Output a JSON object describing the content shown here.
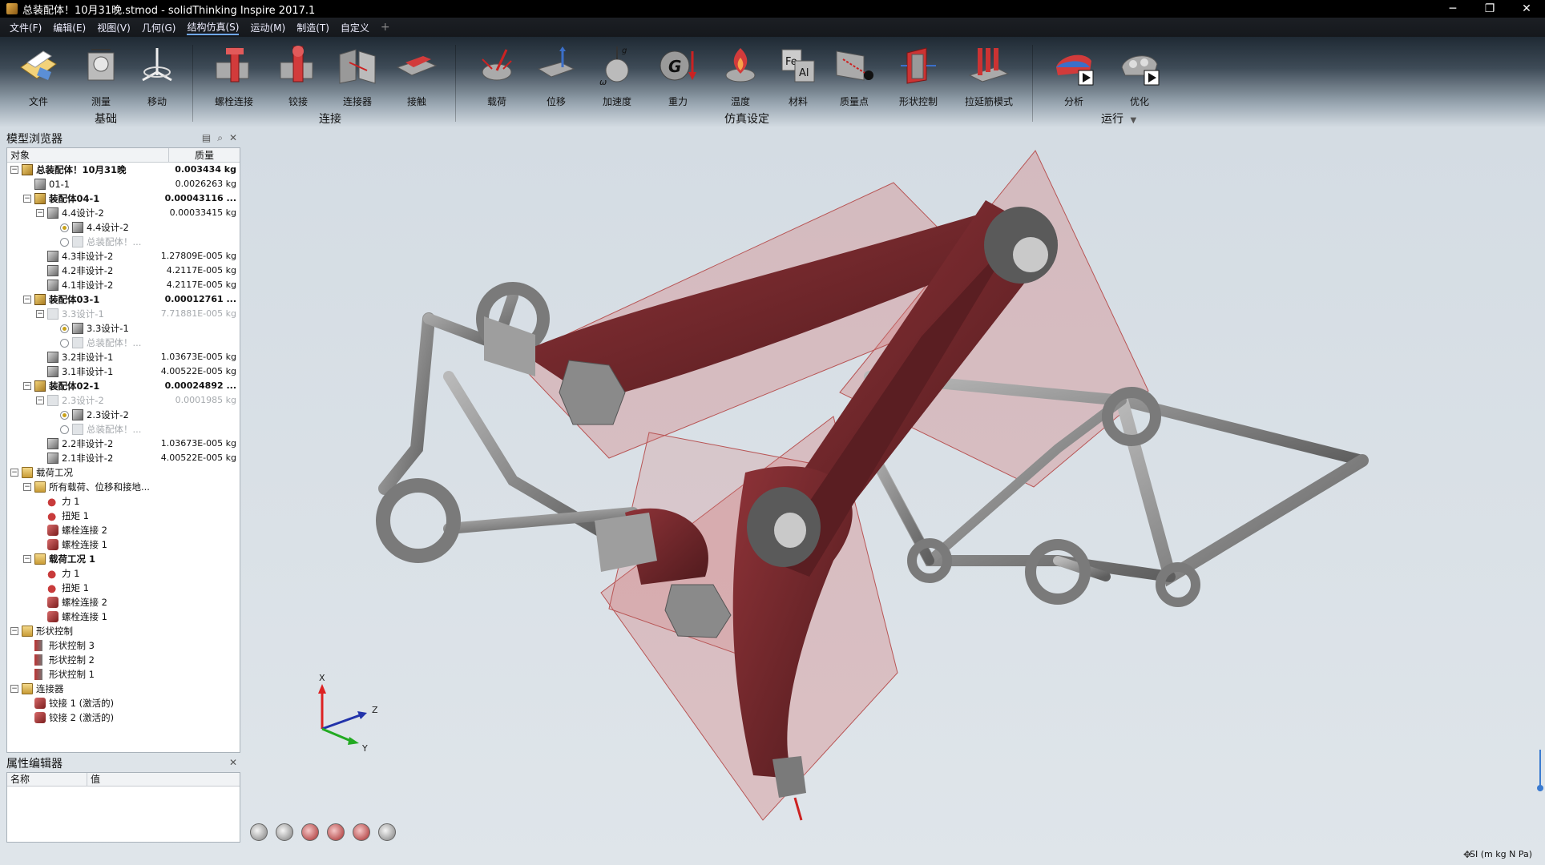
{
  "window": {
    "title": "总装配体！10月31晚.stmod - solidThinking Inspire 2017.1",
    "controls": [
      "─",
      "❐",
      "✕"
    ]
  },
  "menu": {
    "items": [
      "文件(F)",
      "编辑(E)",
      "视图(V)",
      "几何(G)",
      "结构仿真(S)",
      "运动(M)",
      "制造(T)",
      "自定义"
    ],
    "active_index": 4,
    "plus": "+"
  },
  "ribbon": {
    "buttons": [
      {
        "label": "文件",
        "icon": "file-icon"
      },
      {
        "label": "测量",
        "icon": "measure-icon"
      },
      {
        "label": "移动",
        "icon": "move-icon"
      },
      {
        "label": "螺栓连接",
        "icon": "bolt-connection-icon"
      },
      {
        "label": "铰接",
        "icon": "hinge-icon"
      },
      {
        "label": "连接器",
        "icon": "connector-icon"
      },
      {
        "label": "接触",
        "icon": "contact-icon"
      },
      {
        "label": "载荷",
        "icon": "load-icon"
      },
      {
        "label": "位移",
        "icon": "displacement-icon"
      },
      {
        "label": "加速度",
        "icon": "acceleration-icon"
      },
      {
        "label": "重力",
        "icon": "gravity-icon"
      },
      {
        "label": "温度",
        "icon": "temperature-icon"
      },
      {
        "label": "材料",
        "icon": "material-icon"
      },
      {
        "label": "质量点",
        "icon": "point-mass-icon"
      },
      {
        "label": "形状控制",
        "icon": "shape-control-icon"
      },
      {
        "label": "拉延筋模式",
        "icon": "bead-pattern-icon"
      },
      {
        "label": "分析",
        "icon": "analyze-icon"
      },
      {
        "label": "优化",
        "icon": "optimize-icon"
      }
    ],
    "groups": [
      "基础",
      "连接",
      "仿真设定",
      "运行"
    ],
    "run_dropdown": "▼"
  },
  "model_browser": {
    "title": "模型浏览器",
    "col_object": "对象",
    "col_mass": "质量",
    "rows": [
      {
        "name": "总装配体！10月31晚",
        "mass": "0.003434 kg",
        "level": 0,
        "exp": "−",
        "icon": "asm",
        "bold": true
      },
      {
        "name": "01-1",
        "mass": "0.0026263 kg",
        "level": 1,
        "icon": "part"
      },
      {
        "name": "装配体04-1",
        "mass": "0.00043116 ...",
        "level": 1,
        "exp": "−",
        "icon": "asm",
        "bold": true
      },
      {
        "name": "4.4设计-2",
        "mass": "0.00033415 kg",
        "level": 2,
        "exp": "−",
        "icon": "part"
      },
      {
        "name": "4.4设计-2",
        "mass": "",
        "level": 3,
        "radio": "on",
        "icon": "part"
      },
      {
        "name": "总装配体！...",
        "mass": "",
        "level": 3,
        "radio": "off",
        "icon": "ghost",
        "grey": true
      },
      {
        "name": "4.3非设计-2",
        "mass": "1.27809E-005 kg",
        "level": 2,
        "icon": "part"
      },
      {
        "name": "4.2非设计-2",
        "mass": "4.2117E-005 kg",
        "level": 2,
        "icon": "part"
      },
      {
        "name": "4.1非设计-2",
        "mass": "4.2117E-005 kg",
        "level": 2,
        "icon": "part"
      },
      {
        "name": "装配体03-1",
        "mass": "0.00012761 ...",
        "level": 1,
        "exp": "−",
        "icon": "asm",
        "bold": true
      },
      {
        "name": "3.3设计-1",
        "mass": "7.71881E-005 kg",
        "level": 2,
        "exp": "−",
        "icon": "ghost",
        "grey": true
      },
      {
        "name": "3.3设计-1",
        "mass": "",
        "level": 3,
        "radio": "on",
        "icon": "part"
      },
      {
        "name": "总装配体！...",
        "mass": "",
        "level": 3,
        "radio": "off",
        "icon": "ghost",
        "grey": true
      },
      {
        "name": "3.2非设计-1",
        "mass": "1.03673E-005 kg",
        "level": 2,
        "icon": "part"
      },
      {
        "name": "3.1非设计-1",
        "mass": "4.00522E-005 kg",
        "level": 2,
        "icon": "part"
      },
      {
        "name": "装配体02-1",
        "mass": "0.00024892 ...",
        "level": 1,
        "exp": "−",
        "icon": "asm",
        "bold": true
      },
      {
        "name": "2.3设计-2",
        "mass": "0.0001985 kg",
        "level": 2,
        "exp": "−",
        "icon": "ghost",
        "grey": true
      },
      {
        "name": "2.3设计-2",
        "mass": "",
        "level": 3,
        "radio": "on",
        "icon": "part"
      },
      {
        "name": "总装配体！...",
        "mass": "",
        "level": 3,
        "radio": "off",
        "icon": "ghost",
        "grey": true
      },
      {
        "name": "2.2非设计-2",
        "mass": "1.03673E-005 kg",
        "level": 2,
        "icon": "part"
      },
      {
        "name": "2.1非设计-2",
        "mass": "4.00522E-005 kg",
        "level": 2,
        "icon": "part"
      },
      {
        "name": "载荷工况",
        "mass": "",
        "level": 0,
        "exp": "−",
        "icon": "folder"
      },
      {
        "name": "所有载荷、位移和接地...",
        "mass": "",
        "level": 1,
        "exp": "−",
        "icon": "folder"
      },
      {
        "name": "力 1",
        "mass": "",
        "level": 2,
        "icon": "load"
      },
      {
        "name": "扭矩 1",
        "mass": "",
        "level": 2,
        "icon": "load"
      },
      {
        "name": "螺栓连接 2",
        "mass": "",
        "level": 2,
        "icon": "bolt"
      },
      {
        "name": "螺栓连接 1",
        "mass": "",
        "level": 2,
        "icon": "bolt"
      },
      {
        "name": "载荷工况 1",
        "mass": "",
        "level": 1,
        "exp": "−",
        "icon": "folder",
        "bold": true
      },
      {
        "name": "力 1",
        "mass": "",
        "level": 2,
        "icon": "load"
      },
      {
        "name": "扭矩 1",
        "mass": "",
        "level": 2,
        "icon": "load"
      },
      {
        "name": "螺栓连接 2",
        "mass": "",
        "level": 2,
        "icon": "bolt"
      },
      {
        "name": "螺栓连接 1",
        "mass": "",
        "level": 2,
        "icon": "bolt"
      },
      {
        "name": "形状控制",
        "mass": "",
        "level": 0,
        "exp": "−",
        "icon": "folder"
      },
      {
        "name": "形状控制 3",
        "mass": "",
        "level": 1,
        "icon": "shape"
      },
      {
        "name": "形状控制 2",
        "mass": "",
        "level": 1,
        "icon": "shape"
      },
      {
        "name": "形状控制 1",
        "mass": "",
        "level": 1,
        "icon": "shape"
      },
      {
        "name": "连接器",
        "mass": "",
        "level": 0,
        "exp": "−",
        "icon": "folder"
      },
      {
        "name": "铰接 1 (激活的)",
        "mass": "",
        "level": 1,
        "icon": "bolt"
      },
      {
        "name": "铰接 2 (激活的)",
        "mass": "",
        "level": 1,
        "icon": "bolt"
      }
    ]
  },
  "property_editor": {
    "title": "属性编辑器",
    "col_name": "名称",
    "col_value": "值"
  },
  "status": {
    "units": "SI (m kg N Pa)"
  },
  "axes": {
    "x": "X",
    "y": "Y",
    "z": "Z"
  },
  "colors": {
    "model_red": "#7a2a2e",
    "plane_red": "#d47a7a",
    "steel": "#8c8c8c"
  }
}
